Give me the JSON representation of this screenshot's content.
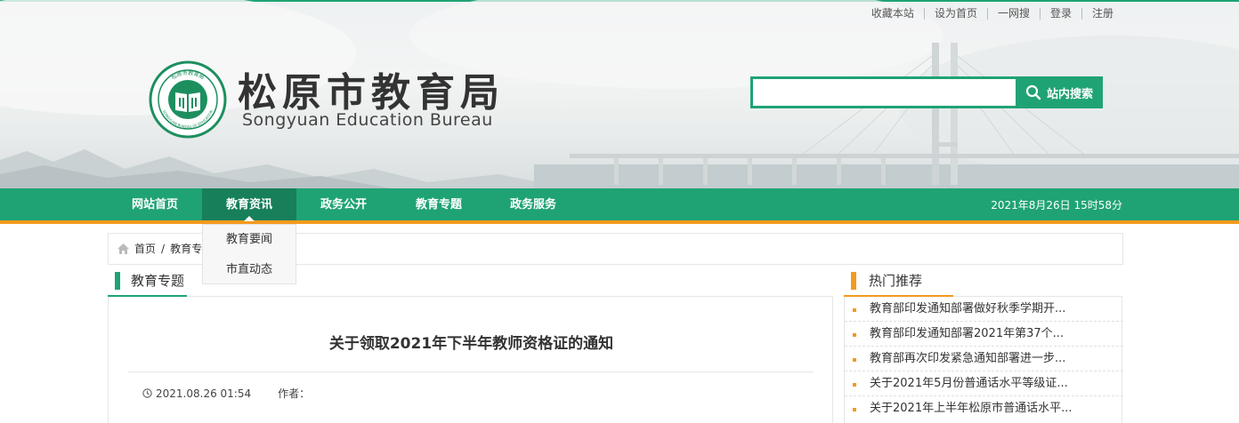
{
  "header": {
    "top_links": [
      "收藏本站",
      "设为首页",
      "一网搜",
      "登录",
      "注册"
    ],
    "site_title": "松原市教育局",
    "site_subtitle": "Songyuan Education Bureau",
    "emblem_text_top": "松原市教育局",
    "emblem_text_bottom": "SONGYUAN BUREAU OF EDUCATION",
    "search": {
      "placeholder": "",
      "value": "",
      "button_label": "站内搜索"
    }
  },
  "nav": {
    "items": [
      "网站首页",
      "教育资讯",
      "政务公开",
      "教育专题",
      "政务服务"
    ],
    "active": "教育资讯",
    "datetime": "2021年8月26日 15时58分",
    "dropdown": [
      "教育要闻",
      "市直动态"
    ]
  },
  "breadcrumb": {
    "home": "首页",
    "separator": "/",
    "current": "教育专题"
  },
  "main": {
    "section_title": "教育专题",
    "article_title": "关于领取2021年下半年教师资格证的通知",
    "date": "2021.08.26 01:54",
    "author_label": "作者："
  },
  "side": {
    "title": "热门推荐",
    "items": [
      "教育部印发通知部署做好秋季学期开...",
      "教育部印发通知部署2021年第37个...",
      "教育部再次印发紧急通知部署进一步...",
      "关于2021年5月份普通话水平等级证...",
      "关于2021年上半年松原市普通话水平..."
    ]
  },
  "colors": {
    "brand_green": "#1fa374",
    "accent_orange": "#f39a1e",
    "active_green": "#177f5a"
  }
}
